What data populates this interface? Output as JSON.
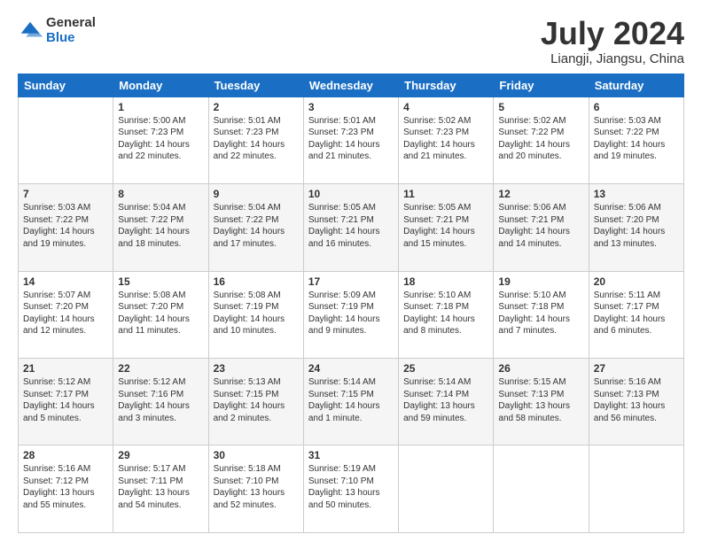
{
  "logo": {
    "general": "General",
    "blue": "Blue"
  },
  "title": "July 2024",
  "location": "Liangji, Jiangsu, China",
  "weekdays": [
    "Sunday",
    "Monday",
    "Tuesday",
    "Wednesday",
    "Thursday",
    "Friday",
    "Saturday"
  ],
  "weeks": [
    [
      {
        "day": "",
        "info": ""
      },
      {
        "day": "1",
        "info": "Sunrise: 5:00 AM\nSunset: 7:23 PM\nDaylight: 14 hours\nand 22 minutes."
      },
      {
        "day": "2",
        "info": "Sunrise: 5:01 AM\nSunset: 7:23 PM\nDaylight: 14 hours\nand 22 minutes."
      },
      {
        "day": "3",
        "info": "Sunrise: 5:01 AM\nSunset: 7:23 PM\nDaylight: 14 hours\nand 21 minutes."
      },
      {
        "day": "4",
        "info": "Sunrise: 5:02 AM\nSunset: 7:23 PM\nDaylight: 14 hours\nand 21 minutes."
      },
      {
        "day": "5",
        "info": "Sunrise: 5:02 AM\nSunset: 7:22 PM\nDaylight: 14 hours\nand 20 minutes."
      },
      {
        "day": "6",
        "info": "Sunrise: 5:03 AM\nSunset: 7:22 PM\nDaylight: 14 hours\nand 19 minutes."
      }
    ],
    [
      {
        "day": "7",
        "info": "Sunrise: 5:03 AM\nSunset: 7:22 PM\nDaylight: 14 hours\nand 19 minutes."
      },
      {
        "day": "8",
        "info": "Sunrise: 5:04 AM\nSunset: 7:22 PM\nDaylight: 14 hours\nand 18 minutes."
      },
      {
        "day": "9",
        "info": "Sunrise: 5:04 AM\nSunset: 7:22 PM\nDaylight: 14 hours\nand 17 minutes."
      },
      {
        "day": "10",
        "info": "Sunrise: 5:05 AM\nSunset: 7:21 PM\nDaylight: 14 hours\nand 16 minutes."
      },
      {
        "day": "11",
        "info": "Sunrise: 5:05 AM\nSunset: 7:21 PM\nDaylight: 14 hours\nand 15 minutes."
      },
      {
        "day": "12",
        "info": "Sunrise: 5:06 AM\nSunset: 7:21 PM\nDaylight: 14 hours\nand 14 minutes."
      },
      {
        "day": "13",
        "info": "Sunrise: 5:06 AM\nSunset: 7:20 PM\nDaylight: 14 hours\nand 13 minutes."
      }
    ],
    [
      {
        "day": "14",
        "info": "Sunrise: 5:07 AM\nSunset: 7:20 PM\nDaylight: 14 hours\nand 12 minutes."
      },
      {
        "day": "15",
        "info": "Sunrise: 5:08 AM\nSunset: 7:20 PM\nDaylight: 14 hours\nand 11 minutes."
      },
      {
        "day": "16",
        "info": "Sunrise: 5:08 AM\nSunset: 7:19 PM\nDaylight: 14 hours\nand 10 minutes."
      },
      {
        "day": "17",
        "info": "Sunrise: 5:09 AM\nSunset: 7:19 PM\nDaylight: 14 hours\nand 9 minutes."
      },
      {
        "day": "18",
        "info": "Sunrise: 5:10 AM\nSunset: 7:18 PM\nDaylight: 14 hours\nand 8 minutes."
      },
      {
        "day": "19",
        "info": "Sunrise: 5:10 AM\nSunset: 7:18 PM\nDaylight: 14 hours\nand 7 minutes."
      },
      {
        "day": "20",
        "info": "Sunrise: 5:11 AM\nSunset: 7:17 PM\nDaylight: 14 hours\nand 6 minutes."
      }
    ],
    [
      {
        "day": "21",
        "info": "Sunrise: 5:12 AM\nSunset: 7:17 PM\nDaylight: 14 hours\nand 5 minutes."
      },
      {
        "day": "22",
        "info": "Sunrise: 5:12 AM\nSunset: 7:16 PM\nDaylight: 14 hours\nand 3 minutes."
      },
      {
        "day": "23",
        "info": "Sunrise: 5:13 AM\nSunset: 7:15 PM\nDaylight: 14 hours\nand 2 minutes."
      },
      {
        "day": "24",
        "info": "Sunrise: 5:14 AM\nSunset: 7:15 PM\nDaylight: 14 hours\nand 1 minute."
      },
      {
        "day": "25",
        "info": "Sunrise: 5:14 AM\nSunset: 7:14 PM\nDaylight: 13 hours\nand 59 minutes."
      },
      {
        "day": "26",
        "info": "Sunrise: 5:15 AM\nSunset: 7:13 PM\nDaylight: 13 hours\nand 58 minutes."
      },
      {
        "day": "27",
        "info": "Sunrise: 5:16 AM\nSunset: 7:13 PM\nDaylight: 13 hours\nand 56 minutes."
      }
    ],
    [
      {
        "day": "28",
        "info": "Sunrise: 5:16 AM\nSunset: 7:12 PM\nDaylight: 13 hours\nand 55 minutes."
      },
      {
        "day": "29",
        "info": "Sunrise: 5:17 AM\nSunset: 7:11 PM\nDaylight: 13 hours\nand 54 minutes."
      },
      {
        "day": "30",
        "info": "Sunrise: 5:18 AM\nSunset: 7:10 PM\nDaylight: 13 hours\nand 52 minutes."
      },
      {
        "day": "31",
        "info": "Sunrise: 5:19 AM\nSunset: 7:10 PM\nDaylight: 13 hours\nand 50 minutes."
      },
      {
        "day": "",
        "info": ""
      },
      {
        "day": "",
        "info": ""
      },
      {
        "day": "",
        "info": ""
      }
    ]
  ]
}
